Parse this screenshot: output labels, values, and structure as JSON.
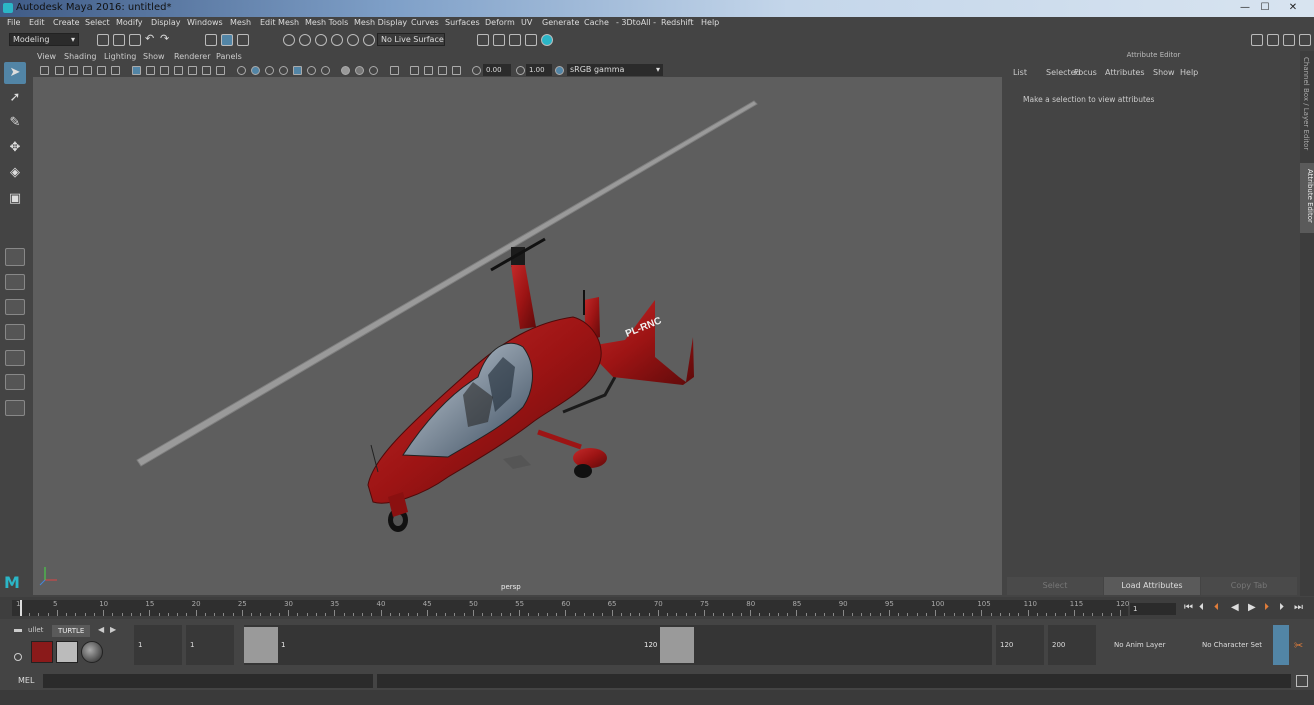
{
  "window": {
    "title": "Autodesk Maya 2016: untitled*"
  },
  "menubar": [
    "File",
    "Edit",
    "Create",
    "Select",
    "Modify",
    "Display",
    "Windows",
    "Mesh",
    "Edit Mesh",
    "Mesh Tools",
    "Mesh Display",
    "Curves",
    "Surfaces",
    "Deform",
    "UV",
    "Generate",
    "Cache",
    "- 3DtoAll -",
    "Redshift",
    "Help"
  ],
  "shelf": {
    "mode": "Modeling",
    "live_surface": "No Live Surface"
  },
  "viewport_menu": [
    "View",
    "Shading",
    "Lighting",
    "Show",
    "Renderer",
    "Panels"
  ],
  "viewport_tools": {
    "exposure": "0.00",
    "gamma": "1.00",
    "color_space": "sRGB gamma"
  },
  "viewport": {
    "camera_label": "persp",
    "model_tail_text": "PL-RNC"
  },
  "attribute_editor": {
    "header": "Attribute Editor",
    "menu": [
      "List",
      "Selected",
      "Focus",
      "Attributes",
      "Show",
      "Help"
    ],
    "message": "Make a selection to view attributes",
    "buttons": [
      "Select",
      "Load Attributes",
      "Copy Tab"
    ]
  },
  "side_tabs": {
    "channel_box": "Channel Box / Layer Editor",
    "attribute_editor": "Attribute Editor"
  },
  "timeline": {
    "ticks": [
      "1",
      "5",
      "10",
      "15",
      "20",
      "25",
      "30",
      "35",
      "40",
      "45",
      "50",
      "55",
      "60",
      "65",
      "70",
      "75",
      "80",
      "85",
      "90",
      "95",
      "100",
      "105",
      "110",
      "115",
      "120"
    ],
    "current_frame": "1"
  },
  "range": {
    "start": "1",
    "anim_start": "1",
    "slider_start": "1",
    "slider_end": "120",
    "anim_end": "120",
    "end": "200",
    "anim_layer": "No Anim Layer",
    "character_set": "No Character Set"
  },
  "shelf_tabs": [
    "ullet",
    "TURTLE"
  ],
  "mel": {
    "label": "MEL"
  }
}
